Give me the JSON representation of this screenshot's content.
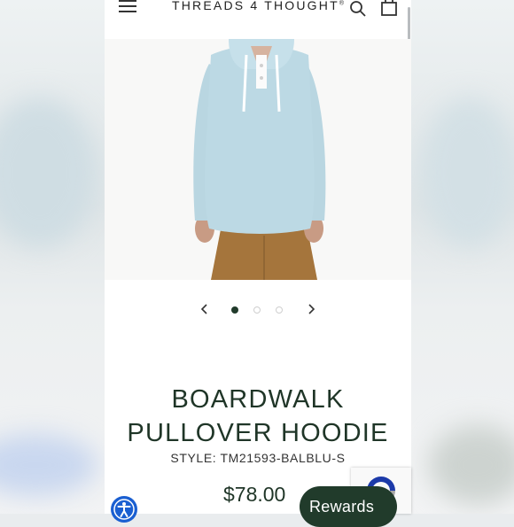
{
  "header": {
    "brand": "THREADS 4 THOUGHT",
    "brand_mark": "®",
    "menu_icon": "hamburger-menu-icon",
    "search_icon": "search-icon",
    "cart_icon": "shopping-bag-icon"
  },
  "carousel": {
    "prev_icon": "chevron-left-icon",
    "next_icon": "chevron-right-icon",
    "total_slides": 3,
    "active_slide": 1
  },
  "product": {
    "title_line1": "BOARDWALK",
    "title_line2": "PULLOVER HOODIE",
    "style": "STYLE: TM21593-BALBLU-S",
    "price": "$78.00"
  },
  "widgets": {
    "rewards_label": "Rewards",
    "accessibility_icon": "accessibility-icon",
    "recaptcha_icon": "recaptcha-icon"
  },
  "colors": {
    "brand_green": "#213b2b",
    "hoodie": "#bcd9e4",
    "pants": "#a5753c",
    "accessibility_blue": "#1a5fd1"
  }
}
